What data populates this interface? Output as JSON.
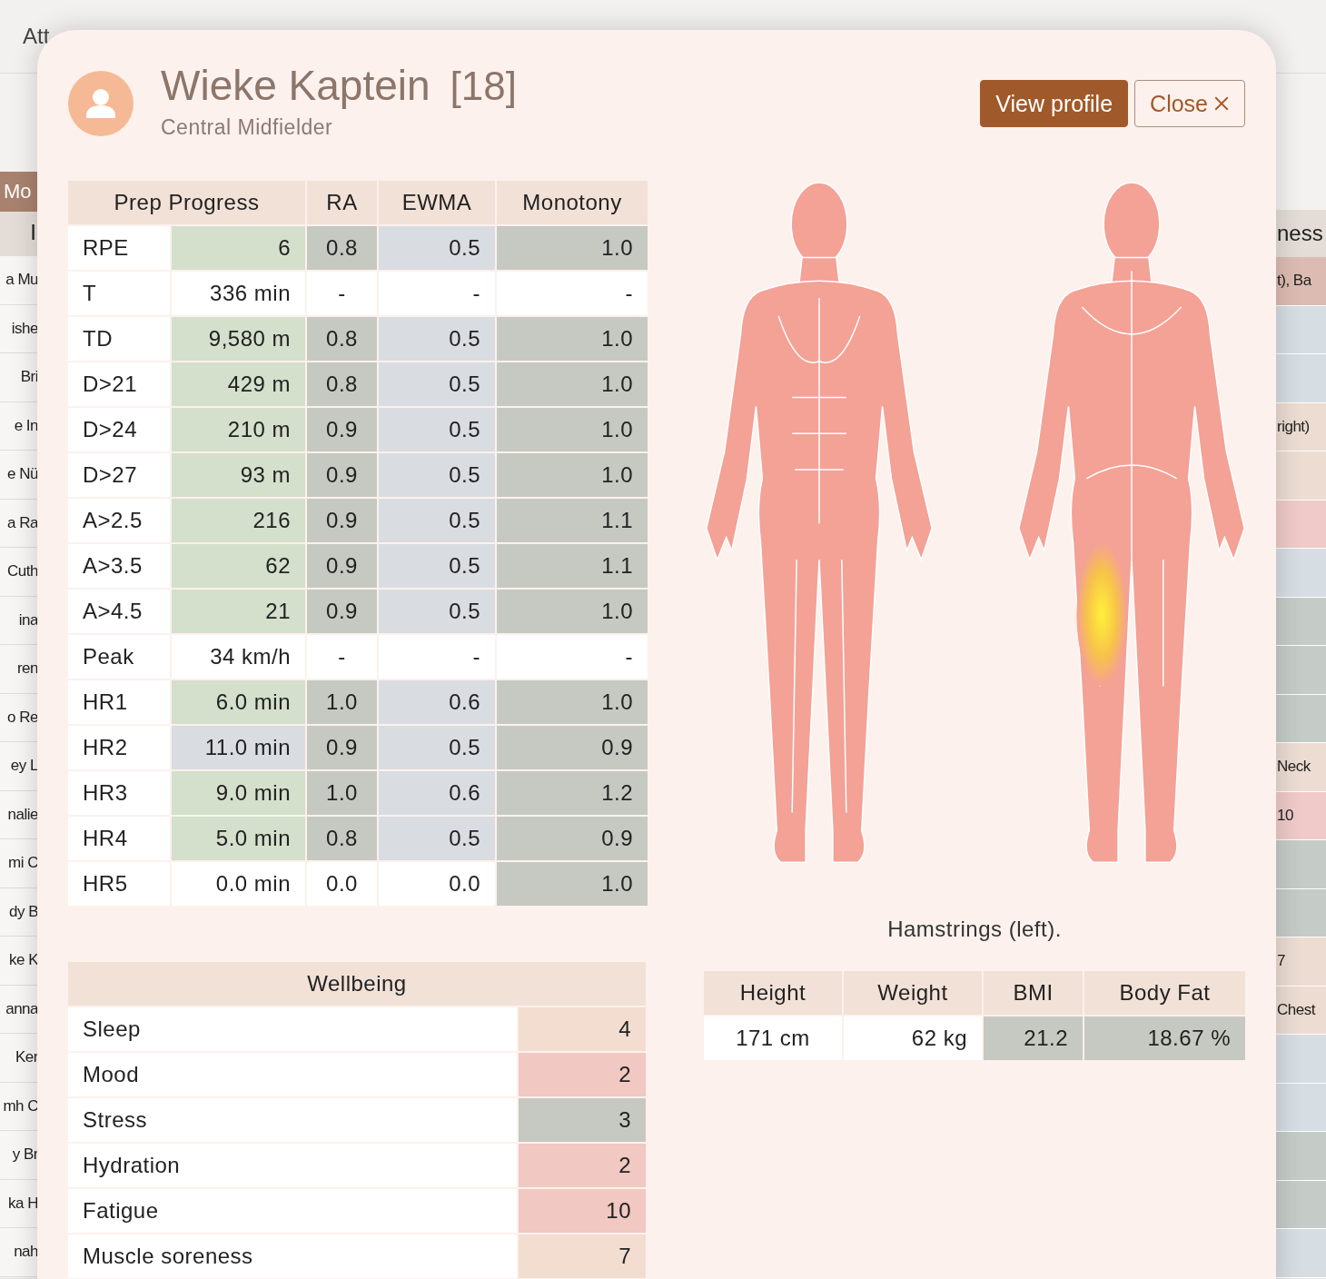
{
  "background_page": {
    "tabs": [
      "Att"
    ],
    "button": "Mo",
    "left_column": {
      "header": "I",
      "rows": [
        "a Mu",
        "ishe",
        "Bri",
        "e In",
        "e Nü",
        "a Ra",
        "Cuth",
        "ina",
        "ren",
        "o Re",
        "ey L",
        "nalie",
        "mi C",
        "dy B",
        "ke K",
        "anna",
        "Ker",
        "mh C",
        "y Br",
        "ka H",
        "nah"
      ]
    },
    "right_column": {
      "header": "ness",
      "rows": [
        {
          "text": "t), Ba",
          "color": "#dcbcb2"
        },
        {
          "text": "",
          "color": "#d6dde3"
        },
        {
          "text": "",
          "color": "#d6dde3"
        },
        {
          "text": "right)",
          "color": "#ecdcd2"
        },
        {
          "text": "",
          "color": "#ecdcd2"
        },
        {
          "text": "",
          "color": "#efcac8"
        },
        {
          "text": "",
          "color": "#d6dde3"
        },
        {
          "text": "",
          "color": "#c5ccc7"
        },
        {
          "text": "",
          "color": "#c5ccc7"
        },
        {
          "text": "",
          "color": "#c5ccc7"
        },
        {
          "text": "Neck",
          "color": "#ecdcd2"
        },
        {
          "text": "10",
          "color": "#efcac8"
        },
        {
          "text": "",
          "color": "#c5ccc7"
        },
        {
          "text": "",
          "color": "#c5ccc7"
        },
        {
          "text": "7",
          "color": "#ecdcd2"
        },
        {
          "text": "Chest",
          "color": "#ecdcd2"
        },
        {
          "text": "",
          "color": "#d6dde3"
        },
        {
          "text": "",
          "color": "#d6dde3"
        },
        {
          "text": "",
          "color": "#c5ccc7"
        },
        {
          "text": "",
          "color": "#c5ccc7"
        },
        {
          "text": "",
          "color": "#d6dde3"
        }
      ]
    }
  },
  "modal": {
    "name": "Wieke Kaptein",
    "number": "[18]",
    "position": "Central Midfielder",
    "buttons": [
      {
        "label": "View profile",
        "kind": "primary"
      },
      {
        "label": "Close",
        "kind": "close"
      }
    ],
    "load_table": {
      "columns": [
        "Prep Progress",
        "RA",
        "EWMA",
        "Monotony"
      ],
      "rows": [
        {
          "label": "RPE",
          "cells": [
            {
              "text": "6",
              "color": "#d4dfcc"
            },
            {
              "text": "0.8",
              "color": "#c6c9c2"
            },
            {
              "text": "0.5",
              "color": "#d9dce1"
            },
            {
              "text": "1.0",
              "color": "#c6c9c2"
            }
          ]
        },
        {
          "label": "T",
          "cells": [
            {
              "text": "336 min",
              "color": "#ffffff"
            },
            {
              "text": "-",
              "color": "#ffffff"
            },
            {
              "text": "-",
              "color": "#ffffff"
            },
            {
              "text": "-",
              "color": "#ffffff"
            }
          ]
        },
        {
          "label": "TD",
          "cells": [
            {
              "text": "9,580 m",
              "color": "#d4dfcc"
            },
            {
              "text": "0.8",
              "color": "#c6c9c2"
            },
            {
              "text": "0.5",
              "color": "#d9dce1"
            },
            {
              "text": "1.0",
              "color": "#c6c9c2"
            }
          ]
        },
        {
          "label": "D>21",
          "cells": [
            {
              "text": "429 m",
              "color": "#d4dfcc"
            },
            {
              "text": "0.8",
              "color": "#c6c9c2"
            },
            {
              "text": "0.5",
              "color": "#d9dce1"
            },
            {
              "text": "1.0",
              "color": "#c6c9c2"
            }
          ]
        },
        {
          "label": "D>24",
          "cells": [
            {
              "text": "210 m",
              "color": "#d4dfcc"
            },
            {
              "text": "0.9",
              "color": "#c6c9c2"
            },
            {
              "text": "0.5",
              "color": "#d9dce1"
            },
            {
              "text": "1.0",
              "color": "#c6c9c2"
            }
          ]
        },
        {
          "label": "D>27",
          "cells": [
            {
              "text": "93 m",
              "color": "#d4dfcc"
            },
            {
              "text": "0.9",
              "color": "#c6c9c2"
            },
            {
              "text": "0.5",
              "color": "#d9dce1"
            },
            {
              "text": "1.0",
              "color": "#c6c9c2"
            }
          ]
        },
        {
          "label": "A>2.5",
          "cells": [
            {
              "text": "216",
              "color": "#d4dfcc"
            },
            {
              "text": "0.9",
              "color": "#c6c9c2"
            },
            {
              "text": "0.5",
              "color": "#d9dce1"
            },
            {
              "text": "1.1",
              "color": "#c6c9c2"
            }
          ]
        },
        {
          "label": "A>3.5",
          "cells": [
            {
              "text": "62",
              "color": "#d4dfcc"
            },
            {
              "text": "0.9",
              "color": "#c6c9c2"
            },
            {
              "text": "0.5",
              "color": "#d9dce1"
            },
            {
              "text": "1.1",
              "color": "#c6c9c2"
            }
          ]
        },
        {
          "label": "A>4.5",
          "cells": [
            {
              "text": "21",
              "color": "#d4dfcc"
            },
            {
              "text": "0.9",
              "color": "#c6c9c2"
            },
            {
              "text": "0.5",
              "color": "#d9dce1"
            },
            {
              "text": "1.0",
              "color": "#c6c9c2"
            }
          ]
        },
        {
          "label": "Peak",
          "cells": [
            {
              "text": "34 km/h",
              "color": "#ffffff"
            },
            {
              "text": "-",
              "color": "#ffffff"
            },
            {
              "text": "-",
              "color": "#ffffff"
            },
            {
              "text": "-",
              "color": "#ffffff"
            }
          ]
        },
        {
          "label": "HR1",
          "cells": [
            {
              "text": "6.0 min",
              "color": "#d4dfcc"
            },
            {
              "text": "1.0",
              "color": "#c6c9c2"
            },
            {
              "text": "0.6",
              "color": "#d9dce1"
            },
            {
              "text": "1.0",
              "color": "#c6c9c2"
            }
          ]
        },
        {
          "label": "HR2",
          "cells": [
            {
              "text": "11.0 min",
              "color": "#d9dce1"
            },
            {
              "text": "0.9",
              "color": "#c6c9c2"
            },
            {
              "text": "0.5",
              "color": "#d9dce1"
            },
            {
              "text": "0.9",
              "color": "#c6c9c2"
            }
          ]
        },
        {
          "label": "HR3",
          "cells": [
            {
              "text": "9.0 min",
              "color": "#d4dfcc"
            },
            {
              "text": "1.0",
              "color": "#c6c9c2"
            },
            {
              "text": "0.6",
              "color": "#d9dce1"
            },
            {
              "text": "1.2",
              "color": "#c6c9c2"
            }
          ]
        },
        {
          "label": "HR4",
          "cells": [
            {
              "text": "5.0 min",
              "color": "#d4dfcc"
            },
            {
              "text": "0.8",
              "color": "#c6c9c2"
            },
            {
              "text": "0.5",
              "color": "#d9dce1"
            },
            {
              "text": "0.9",
              "color": "#c6c9c2"
            }
          ]
        },
        {
          "label": "HR5",
          "cells": [
            {
              "text": "0.0 min",
              "color": "#ffffff"
            },
            {
              "text": "0.0",
              "color": "#ffffff"
            },
            {
              "text": "0.0",
              "color": "#ffffff"
            },
            {
              "text": "1.0",
              "color": "#c6c9c2"
            }
          ]
        }
      ]
    },
    "wellbeing": {
      "title": "Wellbeing",
      "rows": [
        {
          "label": "Sleep",
          "value": "4",
          "color": "#f3ddd0"
        },
        {
          "label": "Mood",
          "value": "2",
          "color": "#f1c8c2"
        },
        {
          "label": "Stress",
          "value": "3",
          "color": "#c6c9c2"
        },
        {
          "label": "Hydration",
          "value": "2",
          "color": "#f1c8c2"
        },
        {
          "label": "Fatigue",
          "value": "10",
          "color": "#f1c8c2"
        },
        {
          "label": "Muscle soreness",
          "value": "7",
          "color": "#f3ddd0"
        }
      ]
    },
    "injury_caption": "Hamstrings (left).",
    "body_stats": {
      "columns": [
        "Height",
        "Weight",
        "BMI",
        "Body Fat"
      ],
      "values": [
        {
          "text": "171 cm",
          "color": "#ffffff"
        },
        {
          "text": "62 kg",
          "color": "#ffffff"
        },
        {
          "text": "21.2",
          "color": "#c6c9c2"
        },
        {
          "text": "18.67 %",
          "color": "#c6c9c2"
        }
      ]
    }
  }
}
